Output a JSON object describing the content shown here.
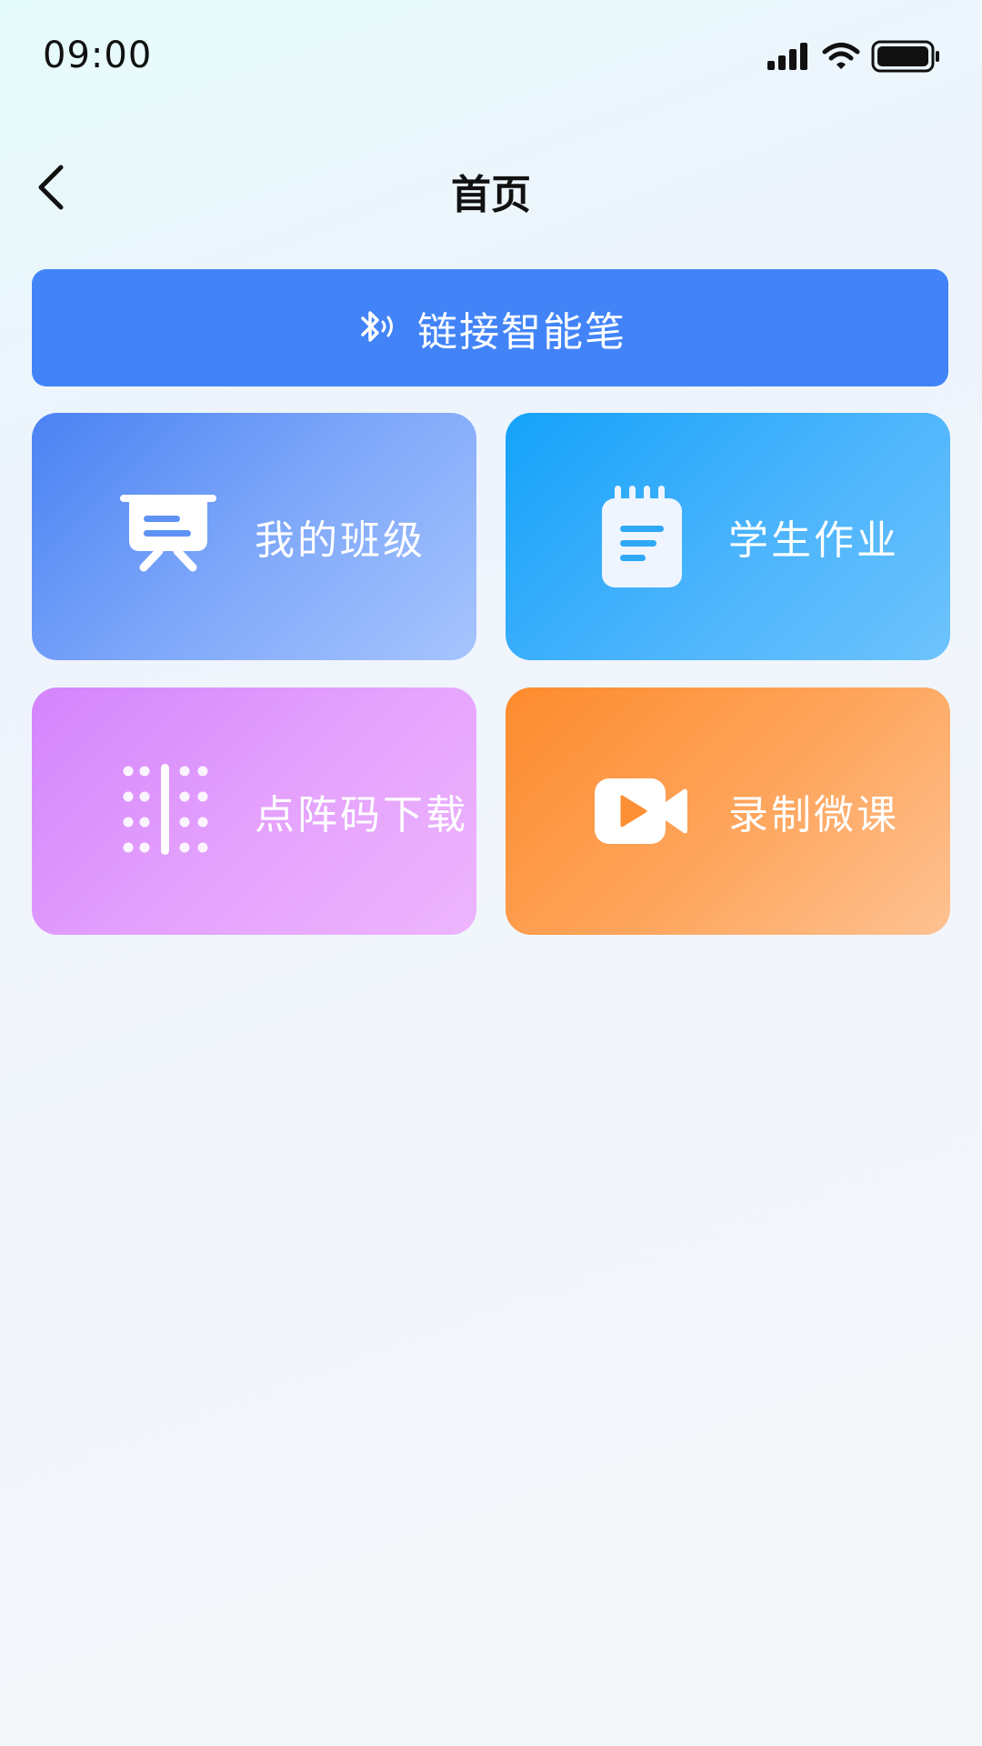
{
  "status_bar": {
    "time": "09:00",
    "icons": [
      "signal-icon",
      "wifi-icon",
      "battery-icon"
    ]
  },
  "nav": {
    "title": "首页",
    "back_icon": "chevron-left-icon"
  },
  "connect_button": {
    "label": "链接智能笔",
    "icon": "bluetooth-icon",
    "color": "#4284f8"
  },
  "cards": [
    {
      "label": "我的班级",
      "icon": "presentation-board-icon"
    },
    {
      "label": "学生作业",
      "icon": "notepad-icon"
    },
    {
      "label": "点阵码下载",
      "icon": "dot-matrix-icon"
    },
    {
      "label": "录制微课",
      "icon": "video-camera-icon"
    }
  ]
}
